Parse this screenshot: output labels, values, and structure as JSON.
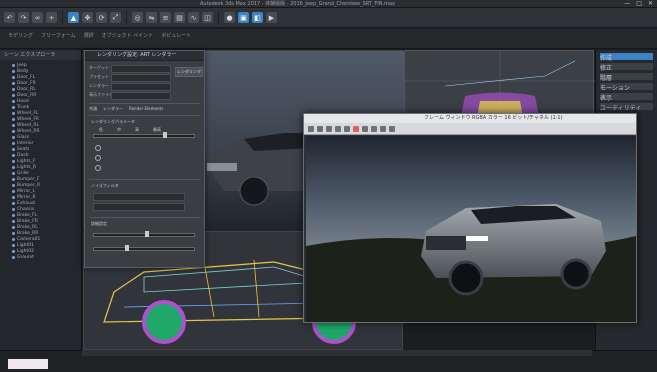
{
  "titlebar": {
    "title": "Autodesk 3ds Max 2017 - 体験版版 - 2016_Jeep_Grand_Cherokee_SRT_FIN.max"
  },
  "window_controls": {
    "minimize": "—",
    "maximize": "□",
    "close": "✕"
  },
  "toolbar": {
    "buttons": [
      "undo-icon",
      "redo-icon",
      "link-icon",
      "unlink-icon",
      "select-icon",
      "move-icon",
      "rotate-icon",
      "scale-icon",
      "snap-icon",
      "mirror-icon",
      "align-icon",
      "layer-icon",
      "curve-icon",
      "schematic-icon",
      "material-icon",
      "render-setup-icon",
      "render-frame-icon",
      "render-icon"
    ]
  },
  "ribbon": {
    "labels": [
      "モデリング",
      "フリーフォーム",
      "選択",
      "オブジェクト ペイント",
      "ポピュレート"
    ]
  },
  "scene_explorer": {
    "header": "シーン エクスプローラ",
    "items": [
      "Jeep",
      "Body",
      "Door_FL",
      "Door_FR",
      "Door_RL",
      "Door_RR",
      "Hood",
      "Trunk",
      "Wheel_FL",
      "Wheel_FR",
      "Wheel_RL",
      "Wheel_RR",
      "Glass",
      "Interior",
      "Seats",
      "Dash",
      "Lights_F",
      "Lights_R",
      "Grille",
      "Bumper_F",
      "Bumper_R",
      "Mirror_L",
      "Mirror_R",
      "Exhaust",
      "Chassis",
      "Brake_FL",
      "Brake_FR",
      "Brake_RL",
      "Brake_RR",
      "Camera01",
      "Light01",
      "Light02",
      "Ground"
    ]
  },
  "render_setup": {
    "title": "レンダリング設定: ART レンダラー",
    "fields": [
      "ターゲット",
      "プリセット",
      "レンダラー",
      "表示ファイル"
    ],
    "render_button": "レンダリング",
    "tabs": [
      "共通",
      "レンダラー",
      "Render Elements"
    ],
    "sections": [
      "レンダリングパラメータ",
      "ノイズフィルタ",
      "詳細設定"
    ],
    "quality_labels": [
      "低",
      "中",
      "高",
      "最高"
    ]
  },
  "frame_window": {
    "title": "フレーム ウィンドウ RGBA カラー 16 ビット/チャネル (1:1)"
  },
  "right_panel": {
    "categories": [
      "作成",
      "修正",
      "階層",
      "モーション",
      "表示",
      "ユーティリティ"
    ]
  },
  "status": {
    "text": ""
  },
  "colors": {
    "accent": "#3c83c6",
    "bg": "#1b1d20"
  }
}
